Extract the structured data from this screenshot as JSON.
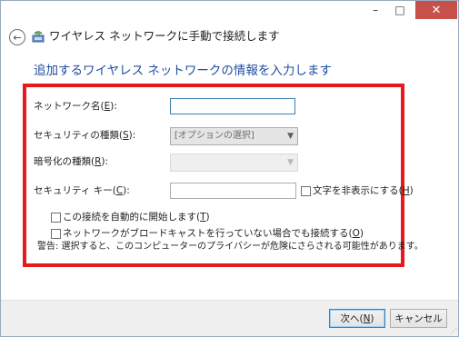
{
  "window": {
    "title": "ワイヤレス ネットワークに手動で接続します",
    "controls": {
      "minimize": "–",
      "maximize": "□",
      "close": "✕"
    }
  },
  "page": {
    "heading": "追加するワイヤレス ネットワークの情報を入力します"
  },
  "form": {
    "network_name": {
      "label": "ネットワーク名(",
      "key": "E",
      "suffix": "):",
      "value": ""
    },
    "security_type": {
      "label": "セキュリティの種類(",
      "key": "S",
      "suffix": "):",
      "value": "[オプションの選択]"
    },
    "encryption_type": {
      "label": "暗号化の種類(",
      "key": "R",
      "suffix": "):",
      "value": ""
    },
    "security_key": {
      "label": "セキュリティ キー(",
      "key": "C",
      "suffix": "):",
      "value": ""
    },
    "hide_chars": {
      "label": "文字を非表示にする(",
      "key": "H",
      "suffix": ")",
      "checked": false
    },
    "auto_connect": {
      "label": "この接続を自動的に開始します(",
      "key": "T",
      "suffix": ")",
      "checked": false
    },
    "connect_hidden": {
      "label": "ネットワークがブロードキャストを行っていない場合でも接続する(",
      "key": "O",
      "suffix": ")",
      "checked": false
    },
    "warning": "警告: 選択すると、このコンピューターのプライバシーが危険にさらされる可能性があります。"
  },
  "footer": {
    "next": {
      "label": "次へ(",
      "key": "N",
      "suffix": ")"
    },
    "cancel": "キャンセル"
  },
  "colors": {
    "highlight_border": "#e6191c",
    "heading": "#1f4fa0",
    "close_button": "#c7504a"
  },
  "icons": {
    "back": "back-arrow-icon",
    "network": "wireless-network-icon"
  }
}
